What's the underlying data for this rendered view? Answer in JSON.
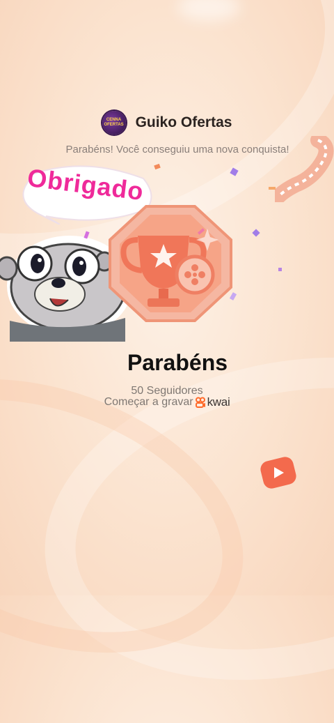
{
  "header": {
    "logo_text": "CENNA OFERTAS",
    "app_name": "Guiko Ofertas"
  },
  "subtitle": "Parabéns! Você conseguiu uma nova conquista!",
  "sticker": {
    "speech_text": "Obrigado"
  },
  "achievement": {
    "heading": "Parabéns",
    "milestone": "50 Seguidores",
    "cta_text": "Começar a gravar",
    "brand": "kwai"
  },
  "colors": {
    "accent_pink": "#ef2a9a",
    "medal_orange": "#f08a66",
    "kwai_orange": "#ff6a2a"
  },
  "icons": [
    "trophy-icon",
    "film-reel-icon",
    "film-strip-icon",
    "play-button-icon",
    "kwai-logo-icon"
  ]
}
